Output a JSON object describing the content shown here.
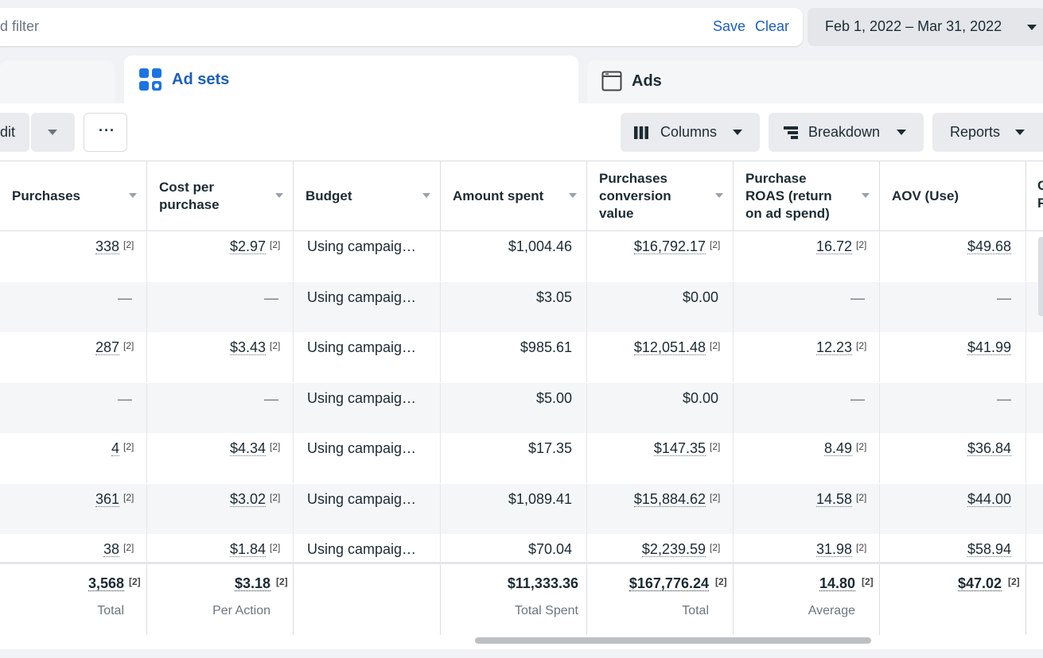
{
  "filter": {
    "placeholder": "d filter",
    "save": "Save",
    "clear": "Clear"
  },
  "date_range": {
    "label": "Feb 1, 2022 – Mar 31, 2022"
  },
  "tabs": {
    "ad_sets": "Ad sets",
    "ads": "Ads"
  },
  "toolbar": {
    "edit": "dit",
    "more": "···",
    "columns": "Columns",
    "breakdown": "Breakdown",
    "reports": "Reports"
  },
  "columns": [
    "Purchases",
    "Cost per purchase",
    "Budget",
    "Amount spent",
    "Purchases conversion value",
    "Purchase ROAS (return on ad spend)",
    "AOV (Use)"
  ],
  "extra_header": "C\nF",
  "footnote": "[2]",
  "rows": [
    {
      "purchases": "338",
      "cpp": "$2.97",
      "budget": "Using campaig…",
      "spent": "$1,004.46",
      "conv_value": "$16,792.17",
      "roas": "16.72",
      "aov": "$49.68"
    },
    {
      "purchases": "—",
      "cpp": "—",
      "budget": "Using campaig…",
      "spent": "$3.05",
      "conv_value": "$0.00",
      "roas": "—",
      "aov": "—"
    },
    {
      "purchases": "287",
      "cpp": "$3.43",
      "budget": "Using campaig…",
      "spent": "$985.61",
      "conv_value": "$12,051.48",
      "roas": "12.23",
      "aov": "$41.99"
    },
    {
      "purchases": "—",
      "cpp": "—",
      "budget": "Using campaig…",
      "spent": "$5.00",
      "conv_value": "$0.00",
      "roas": "—",
      "aov": "—"
    },
    {
      "purchases": "4",
      "cpp": "$4.34",
      "budget": "Using campaig…",
      "spent": "$17.35",
      "conv_value": "$147.35",
      "roas": "8.49",
      "aov": "$36.84"
    },
    {
      "purchases": "361",
      "cpp": "$3.02",
      "budget": "Using campaig…",
      "spent": "$1,089.41",
      "conv_value": "$15,884.62",
      "roas": "14.58",
      "aov": "$44.00"
    },
    {
      "purchases": "38",
      "cpp": "$1.84",
      "budget": "Using campaig…",
      "spent": "$70.04",
      "conv_value": "$2,239.59",
      "roas": "31.98",
      "aov": "$58.94"
    }
  ],
  "totals": {
    "purchases": {
      "value": "3,568",
      "sub": "Total"
    },
    "cpp": {
      "value": "$3.18",
      "sub": "Per Action"
    },
    "spent": {
      "value": "$11,333.36",
      "sub": "Total Spent"
    },
    "conv_value": {
      "value": "$167,776.24",
      "sub": "Total"
    },
    "roas": {
      "value": "14.80",
      "sub": "Average"
    },
    "aov": {
      "value": "$47.02",
      "sub": ""
    }
  }
}
